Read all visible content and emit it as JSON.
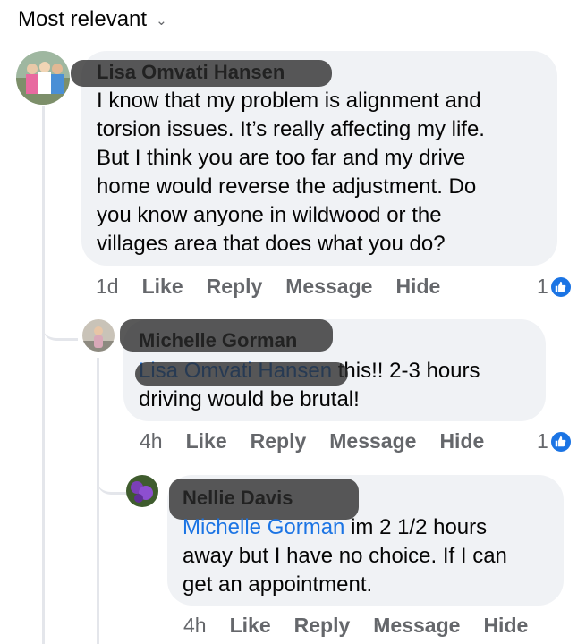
{
  "sort": {
    "label": "Most relevant"
  },
  "comments": [
    {
      "author": "Lisa Omvati Hansen",
      "text": "I know that my problem is alignment and torsion issues. It’s really affecting my life. But I think you are too far and my drive home would reverse the adjustment. Do you know anyone in wildwood or the villages area that does what you do?",
      "lines": [
        "I know that my problem is alignment and",
        "torsion issues. It’s really affecting my life.",
        "But I think you are too far and my drive",
        "home would reverse the adjustment. Do",
        "you know anyone in wildwood or the",
        "villages area that does what you do?"
      ],
      "time": "1d",
      "reactions": "1"
    },
    {
      "author": "Michelle Gorman",
      "mention": "Lisa Omvati Hansen",
      "text_after_mention": " this!! 2-3 hours",
      "line2": "driving would be brutal!",
      "time": "4h",
      "reactions": "1"
    },
    {
      "author": "Nellie Davis",
      "mention": "Michelle Gorman",
      "text_after_mention": " im 2 1/2 hours",
      "line2": "away but I have no choice. If I can",
      "line3": "get an appointment.",
      "time": "4h"
    }
  ],
  "actions": {
    "like": "Like",
    "reply": "Reply",
    "message": "Message",
    "hide": "Hide"
  },
  "colors": {
    "bubble": "#f0f2f5",
    "meta": "#65676b",
    "link": "#1b74e4",
    "line": "#e4e6eb"
  },
  "icons": {
    "sort": "chevron-down-icon",
    "reaction": "like-thumb-icon"
  }
}
